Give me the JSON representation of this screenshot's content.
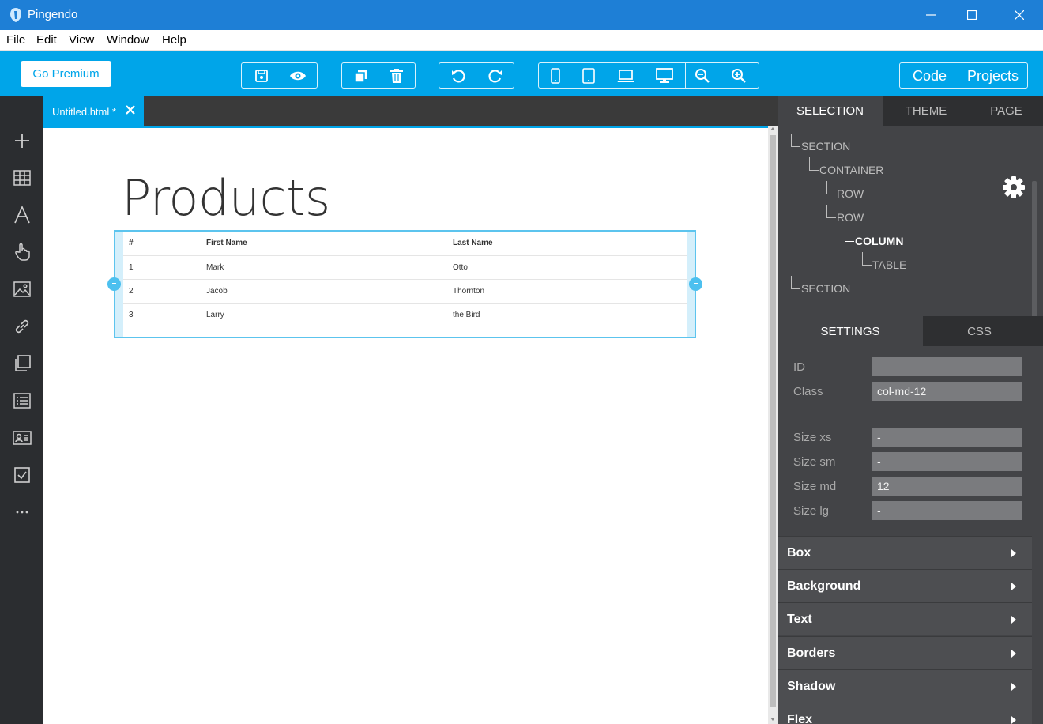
{
  "window": {
    "title": "Pingendo"
  },
  "menu": [
    "File",
    "Edit",
    "View",
    "Window",
    "Help"
  ],
  "toolbar": {
    "go_premium": "Go Premium",
    "code": "Code",
    "projects": "Projects"
  },
  "document": {
    "tab_label": "Untitled.html *",
    "heading": "Products",
    "table": {
      "headers": [
        "#",
        "First Name",
        "Last Name"
      ],
      "rows": [
        [
          "1",
          "Mark",
          "Otto"
        ],
        [
          "2",
          "Jacob",
          "Thornton"
        ],
        [
          "3",
          "Larry",
          "the Bird"
        ]
      ]
    }
  },
  "panel": {
    "tabs": [
      "SELECTION",
      "THEME",
      "PAGE"
    ],
    "tree": [
      "SECTION",
      "CONTAINER",
      "ROW",
      "ROW",
      "COLUMN",
      "TABLE",
      "SECTION"
    ],
    "settings_tabs": [
      "SETTINGS",
      "CSS"
    ],
    "fields": [
      {
        "label": "ID",
        "value": ""
      },
      {
        "label": "Class",
        "value": "col-md-12"
      }
    ],
    "sizes": [
      {
        "label": "Size xs",
        "value": "-"
      },
      {
        "label": "Size sm",
        "value": "-"
      },
      {
        "label": "Size md",
        "value": "12"
      },
      {
        "label": "Size lg",
        "value": "-"
      }
    ],
    "sections": [
      "Box",
      "Background",
      "Text",
      "Borders",
      "Shadow",
      "Flex"
    ]
  },
  "colors": {
    "titlebar": "#1e7fd6",
    "toolbar": "#00a5e9",
    "panel": "#434447",
    "sidebar": "#2b2d30"
  }
}
